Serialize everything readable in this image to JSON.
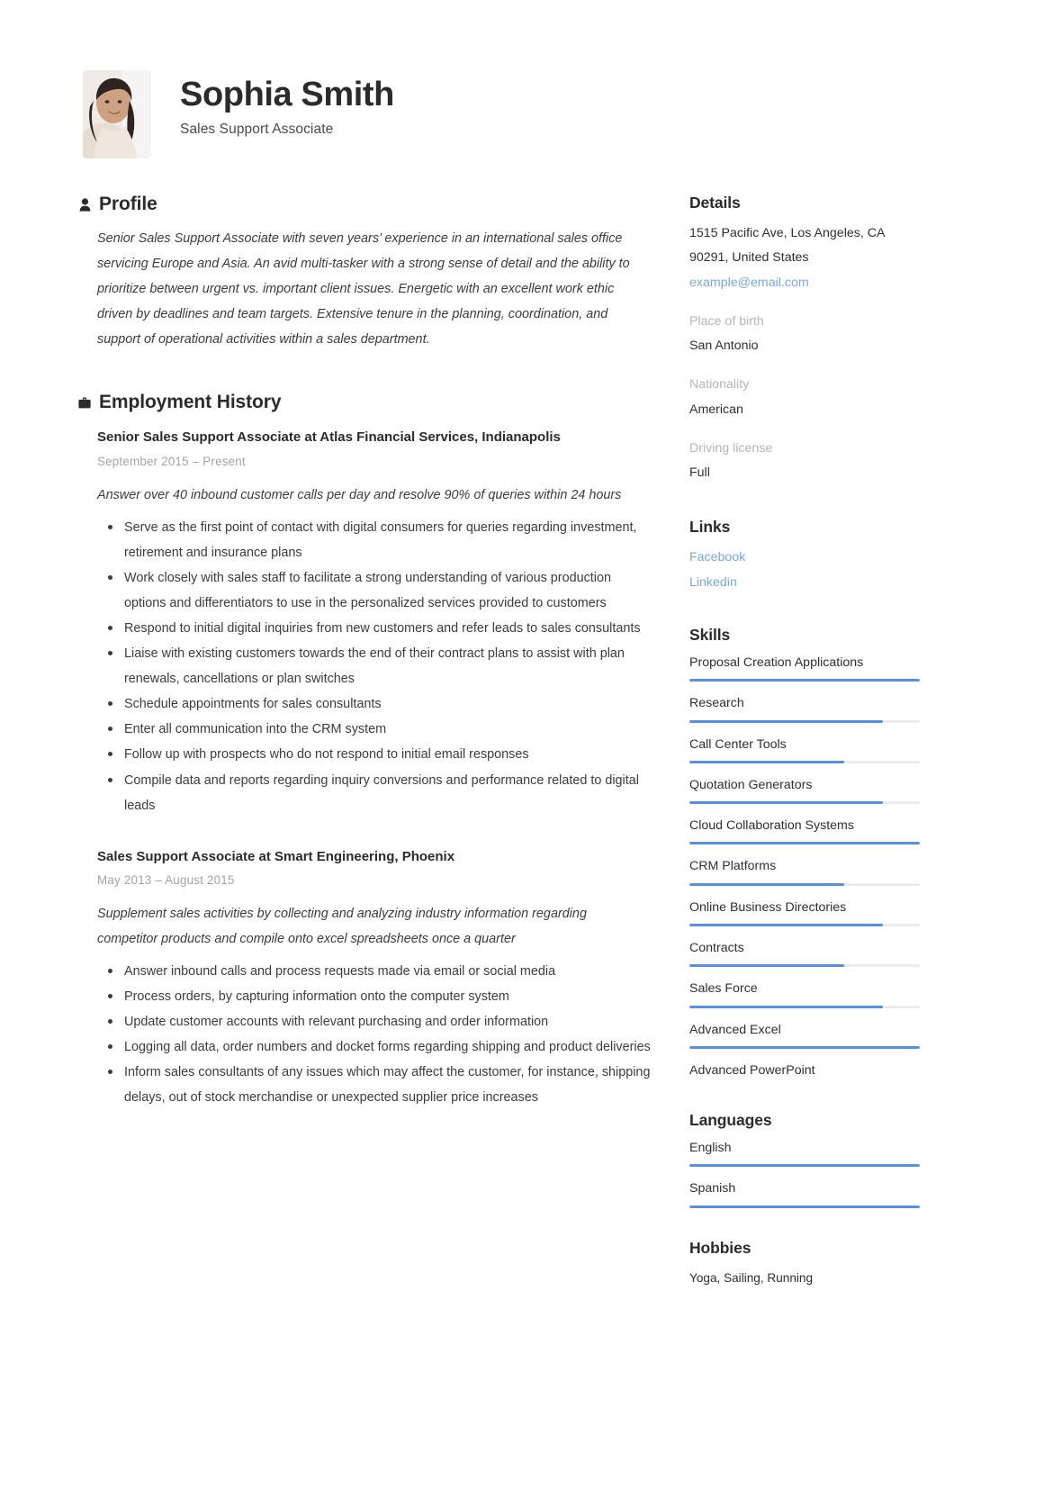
{
  "header": {
    "name": "Sophia Smith",
    "job_title": "Sales Support Associate",
    "avatar_alt": "portrait-photo"
  },
  "profile": {
    "section_title": "Profile",
    "icon": "person-icon",
    "text": "Senior Sales Support Associate with seven years’ experience in an international sales office servicing Europe and Asia. An avid multi-tasker with a strong sense of detail and the ability to prioritize between urgent vs. important client issues. Energetic with an excellent work ethic driven by deadlines and team targets. Extensive tenure in the planning, coordination, and support of operational activities within a sales department."
  },
  "employment": {
    "section_title": "Employment History",
    "icon": "briefcase-icon",
    "jobs": [
      {
        "heading": "Senior Sales Support Associate at Atlas Financial Services, Indianapolis",
        "dates": "September 2015  –  Present",
        "description": "Answer over 40 inbound customer calls per day and resolve 90% of queries within 24 hours",
        "bullets": [
          "Serve as the first point of contact with digital consumers for queries regarding investment, retirement and insurance plans",
          "Work closely with sales staff to facilitate a strong understanding of various production options and differentiators to use in the personalized services provided to customers",
          "Respond to initial digital inquiries from new customers and refer leads to sales consultants",
          "Liaise with existing customers towards the end of their contract plans to assist with plan renewals, cancellations or plan switches",
          "Schedule appointments for sales consultants",
          "Enter all communication into the CRM system",
          "Follow up with prospects who do not respond to initial email responses",
          "Compile data and reports regarding inquiry conversions and performance related to digital leads"
        ]
      },
      {
        "heading": "Sales Support Associate at Smart Engineering, Phoenix",
        "dates": "May 2013  –  August 2015",
        "description": "Supplement sales activities by collecting and analyzing industry information regarding competitor products and compile onto excel spreadsheets once a quarter",
        "bullets": [
          "Answer inbound calls and process requests made via email or social media",
          "Process orders, by capturing information onto the computer system",
          "Update customer accounts with relevant purchasing and order information",
          "Logging all data, order numbers and docket forms regarding shipping and product deliveries",
          "Inform sales consultants of any issues which may affect the customer, for instance, shipping delays, out of stock merchandise or unexpected supplier price increases"
        ]
      }
    ]
  },
  "details": {
    "section_title": "Details",
    "address_line1": "1515 Pacific Ave, Los Angeles, CA",
    "address_line2": "90291, United States",
    "email": "example@email.com",
    "fields": [
      {
        "label": "Place of birth",
        "value": "San Antonio"
      },
      {
        "label": "Nationality",
        "value": "American"
      },
      {
        "label": "Driving license",
        "value": "Full"
      }
    ]
  },
  "links": {
    "section_title": "Links",
    "items": [
      {
        "label": "Facebook"
      },
      {
        "label": "Linkedin"
      }
    ]
  },
  "skills": {
    "section_title": "Skills",
    "items": [
      {
        "name": "Proposal Creation Applications",
        "level": 100
      },
      {
        "name": "Research",
        "level": 84
      },
      {
        "name": "Call Center Tools",
        "level": 67
      },
      {
        "name": "Quotation Generators",
        "level": 84
      },
      {
        "name": "Cloud Collaboration Systems",
        "level": 100
      },
      {
        "name": "CRM Platforms",
        "level": 67
      },
      {
        "name": "Online Business Directories",
        "level": 84
      },
      {
        "name": "Contracts",
        "level": 67
      },
      {
        "name": "Sales Force",
        "level": 84
      },
      {
        "name": "Advanced Excel",
        "level": 100
      },
      {
        "name": "Advanced PowerPoint",
        "level": 0
      }
    ]
  },
  "languages": {
    "section_title": "Languages",
    "items": [
      {
        "name": "English",
        "level": 100
      },
      {
        "name": "Spanish",
        "level": 100
      }
    ]
  },
  "hobbies": {
    "section_title": "Hobbies",
    "text": "Yoga, Sailing, Running"
  },
  "colors": {
    "accent": "#5b8fd0",
    "link": "#7ba7d7",
    "text": "#2f2f2f",
    "muted": "#b5b5b5",
    "bar_track": "#ececec"
  }
}
